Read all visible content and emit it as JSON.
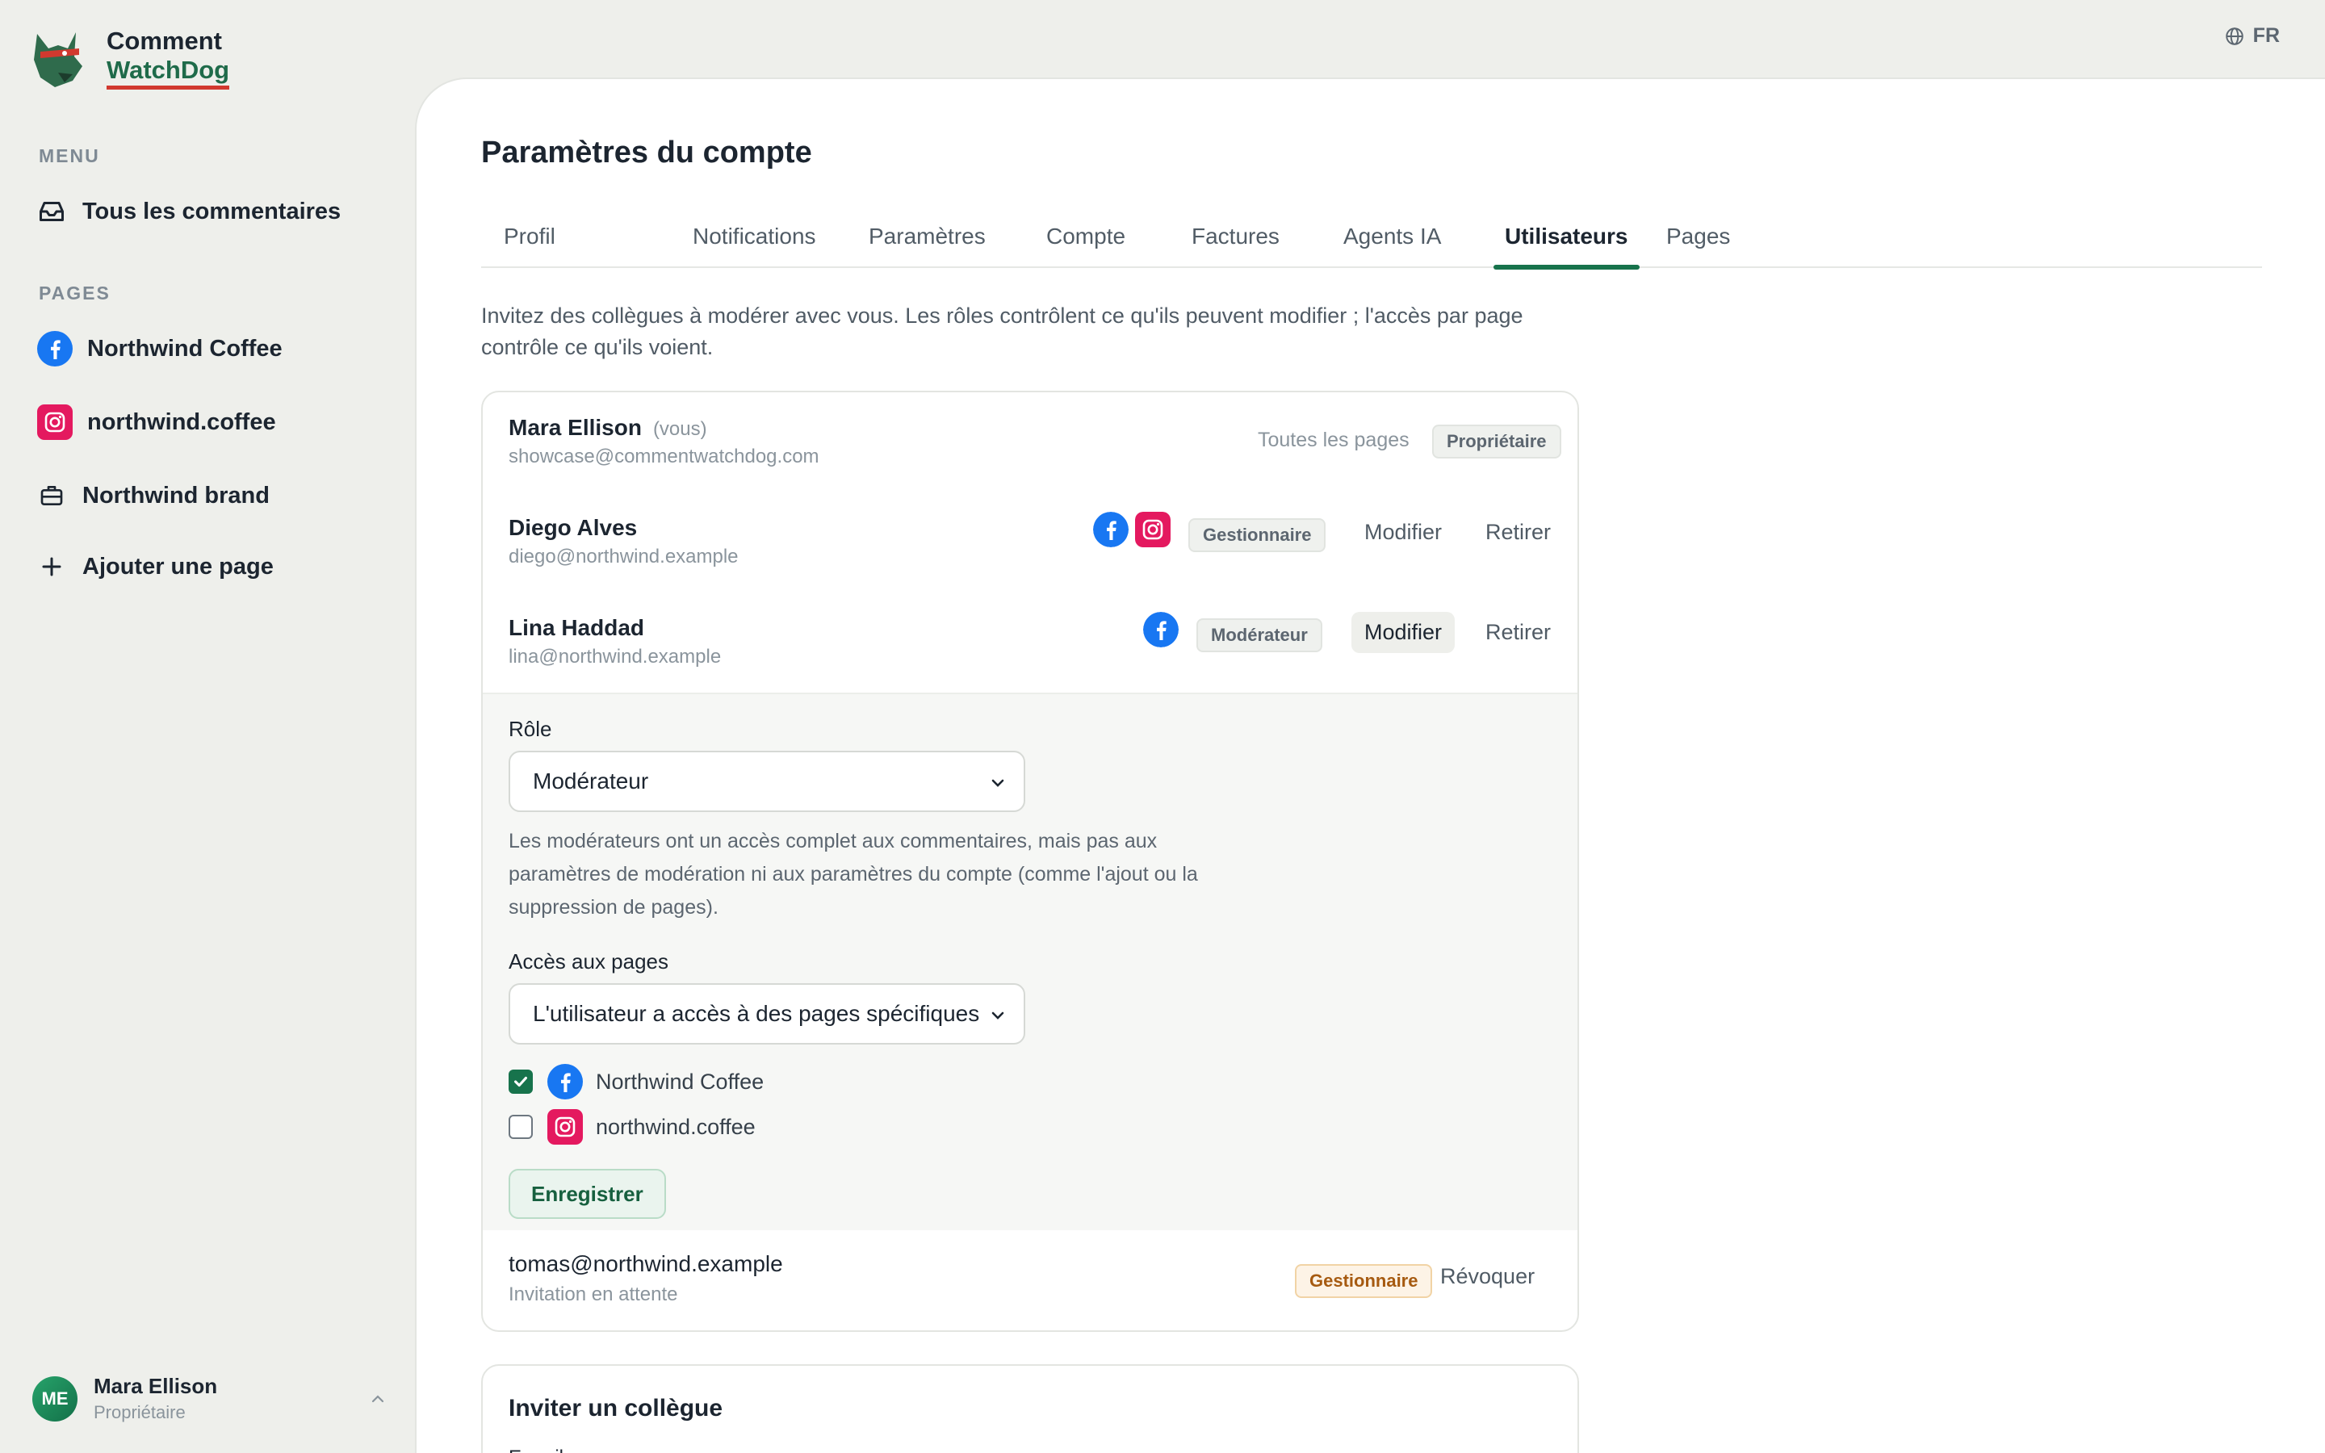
{
  "app": {
    "name_line1": "Comment",
    "name_line2": "WatchDog",
    "language": "FR"
  },
  "sidebar": {
    "menu_label": "MENU",
    "menu_items": [
      {
        "label": "Tous les commentaires",
        "icon": "inbox-icon"
      }
    ],
    "pages_label": "PAGES",
    "pages": [
      {
        "label": "Northwind Coffee",
        "icon": "facebook-icon"
      },
      {
        "label": "northwind.coffee",
        "icon": "instagram-icon"
      },
      {
        "label": "Northwind brand",
        "icon": "briefcase-icon"
      }
    ],
    "add_page": "Ajouter une page",
    "user": {
      "initials": "ME",
      "name": "Mara Ellison",
      "role": "Propriétaire"
    }
  },
  "main": {
    "title": "Paramètres du compte",
    "tabs": [
      {
        "label": "Profil"
      },
      {
        "label": "Notifications"
      },
      {
        "label": "Paramètres"
      },
      {
        "label": "Compte"
      },
      {
        "label": "Factures"
      },
      {
        "label": "Agents IA"
      },
      {
        "label": "Utilisateurs",
        "active": true
      },
      {
        "label": "Pages"
      }
    ],
    "intro": "Invitez des collègues à modérer avec vous. Les rôles contrôlent ce qu'ils peuvent modifier ; l'accès par page contrôle ce qu'ils voient."
  },
  "users": [
    {
      "name": "Mara Ellison",
      "you": "(vous)",
      "email": "showcase@commentwatchdog.com",
      "access": "Toutes les pages",
      "role": "Propriétaire"
    },
    {
      "name": "Diego Alves",
      "email": "diego@northwind.example",
      "role": "Gestionnaire",
      "edit": "Modifier",
      "remove": "Retirer"
    },
    {
      "name": "Lina Haddad",
      "email": "lina@northwind.example",
      "role": "Modérateur",
      "edit": "Modifier",
      "remove": "Retirer"
    }
  ],
  "edit_form": {
    "role_label": "Rôle",
    "role_value": "Modérateur",
    "help": "Les modérateurs ont un accès complet aux commentaires, mais pas aux paramètres de modération ni aux paramètres du compte (comme l'ajout ou la suppression de pages).",
    "access_label": "Accès aux pages",
    "access_value": "L'utilisateur a accès à des pages spécifiques",
    "pages": [
      {
        "label": "Northwind Coffee",
        "checked": true,
        "icon": "facebook-icon"
      },
      {
        "label": "northwind.coffee",
        "checked": false,
        "icon": "instagram-icon"
      }
    ],
    "save": "Enregistrer"
  },
  "pending": {
    "email": "tomas@northwind.example",
    "status": "Invitation en attente",
    "role": "Gestionnaire",
    "revoke": "Révoquer"
  },
  "invite": {
    "title": "Inviter un collègue",
    "email_label": "E-mail"
  },
  "colors": {
    "accent": "#17734c",
    "facebook": "#1877f2",
    "instagram": "#e4195f",
    "warn": "#a65a10"
  }
}
